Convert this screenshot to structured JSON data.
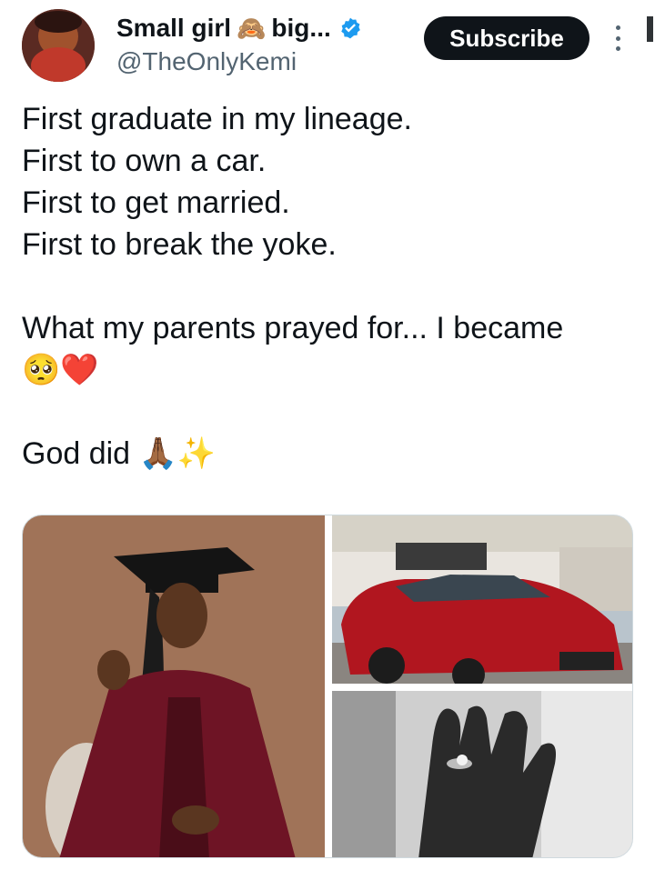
{
  "author": {
    "name": "Small girl",
    "name_emoji": "🙈",
    "name_suffix": "big...",
    "handle": "@TheOnlyKemi",
    "verified": true,
    "verified_color": "#1d9bf0"
  },
  "actions": {
    "subscribe_label": "Subscribe",
    "more_icon": "more-vertical-icon"
  },
  "tweet": {
    "lines": [
      "First graduate in my lineage.",
      "First to own a car.",
      "First to get married.",
      "First to break the yoke."
    ],
    "line2": "What my parents prayed for... I became",
    "line2_emoji": "🥺❤️",
    "line3": "God did 🙏🏾✨"
  },
  "media": {
    "images": [
      {
        "subject": "graduation-portrait"
      },
      {
        "subject": "red-car"
      },
      {
        "subject": "engagement-ring"
      }
    ]
  }
}
